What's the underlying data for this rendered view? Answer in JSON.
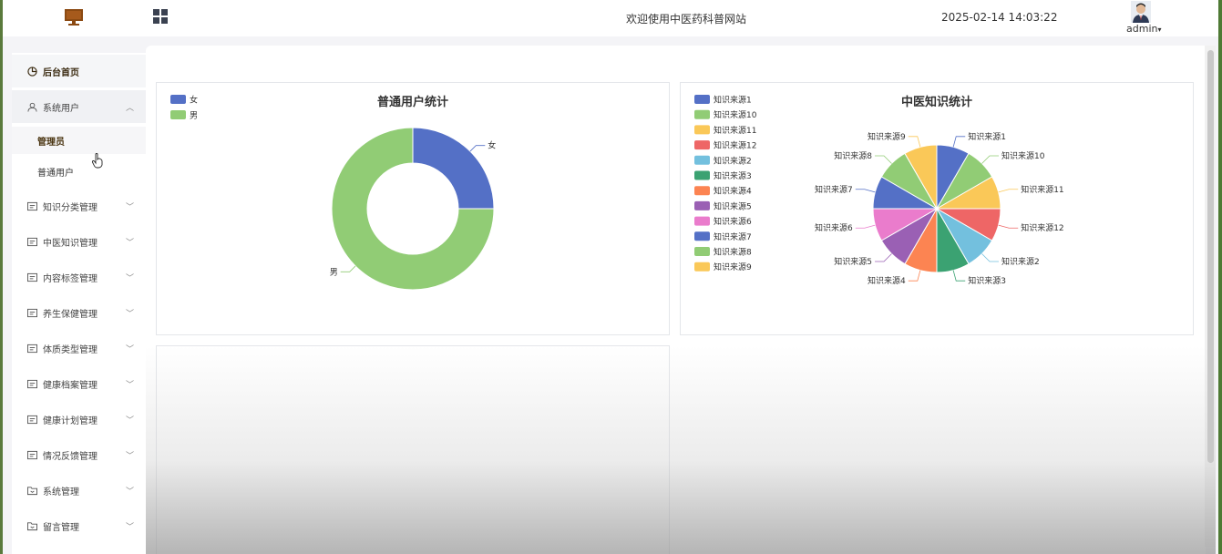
{
  "header": {
    "welcome": "欢迎使用中医药科普网站",
    "datetime": "2025-02-14 14:03:22",
    "user": "admin"
  },
  "sidebar": {
    "home": "后台首页",
    "system_users": "系统用户",
    "sub_admin": "管理员",
    "sub_users": "普通用户",
    "items": [
      "知识分类管理",
      "中医知识管理",
      "内容标签管理",
      "养生保健管理",
      "体质类型管理",
      "健康档案管理",
      "健康计划管理",
      "情况反馈管理",
      "系统管理",
      "留言管理"
    ]
  },
  "chart_data": [
    {
      "type": "pie",
      "variant": "donut",
      "title": "普通用户统计",
      "legend_position": "top-left",
      "categories": [
        "女",
        "男"
      ],
      "values": [
        1,
        3
      ],
      "colors": [
        "#5470c6",
        "#91cc75"
      ]
    },
    {
      "type": "pie",
      "title": "中医知识统计",
      "legend_position": "top-left",
      "categories": [
        "知识来源1",
        "知识来源10",
        "知识来源11",
        "知识来源12",
        "知识来源2",
        "知识来源3",
        "知识来源4",
        "知识来源5",
        "知识来源6",
        "知识来源7",
        "知识来源8",
        "知识来源9"
      ],
      "values": [
        1,
        1,
        1,
        1,
        1,
        1,
        1,
        1,
        1,
        1,
        1,
        1
      ],
      "colors": [
        "#5470c6",
        "#91cc75",
        "#fac858",
        "#ee6666",
        "#73c0de",
        "#3ba272",
        "#fc8452",
        "#9a60b4",
        "#ea7ccc",
        "#5470c6",
        "#91cc75",
        "#fac858"
      ]
    }
  ]
}
